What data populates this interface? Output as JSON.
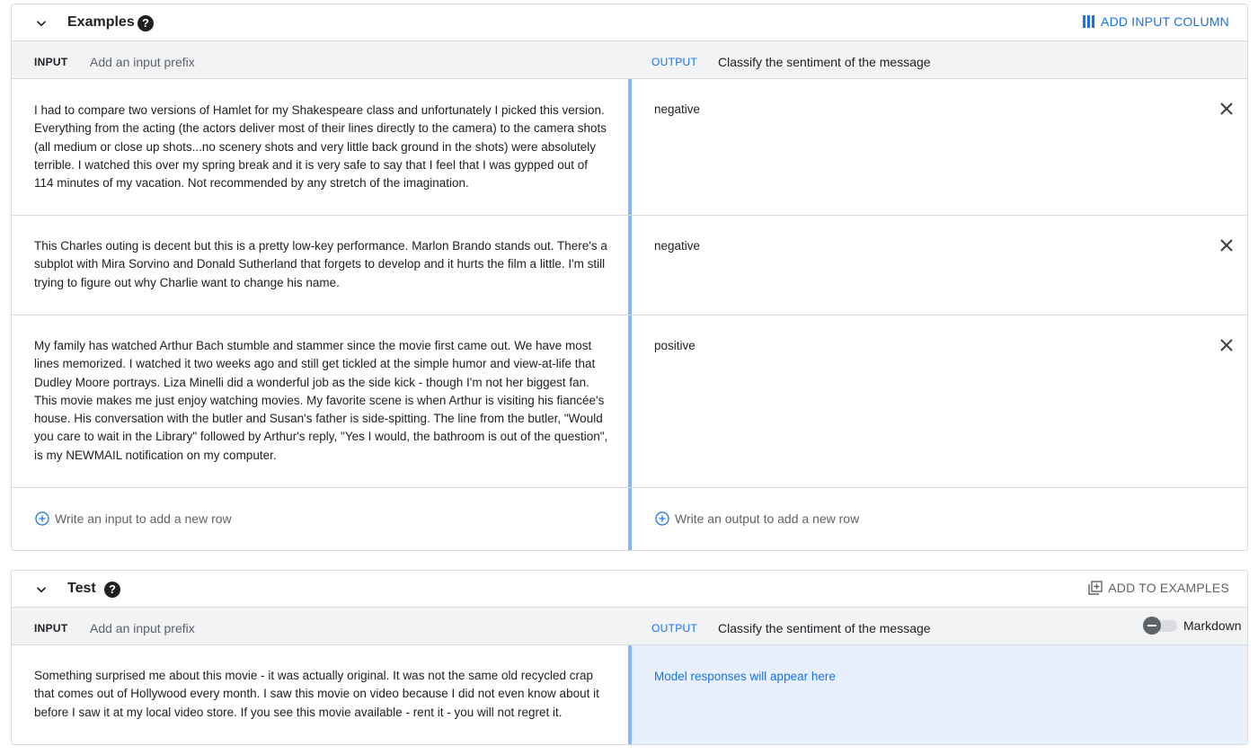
{
  "examples": {
    "title": "Examples",
    "help_icon": "?",
    "add_column_label": "ADD INPUT COLUMN",
    "input_header": "INPUT",
    "input_prefix_placeholder": "Add an input prefix",
    "output_header": "OUTPUT",
    "output_prefix": "Classify the sentiment of the message",
    "rows": [
      {
        "input": "I had to compare two versions of Hamlet for my Shakespeare class and unfortunately I picked this version. Everything from the acting (the actors deliver most of their lines directly to the camera) to the camera shots (all medium or close up shots...no scenery shots and very little back ground in the shots) were absolutely terrible. I watched this over my spring break and it is very safe to say that I feel that I was gypped out of 114 minutes of my vacation. Not recommended by any stretch of the imagination.",
        "output": "negative"
      },
      {
        "input": "This Charles outing is decent but this is a pretty low-key performance. Marlon Brando stands out. There's a subplot with Mira Sorvino and Donald Sutherland that forgets to develop and it hurts the film a little. I'm still trying to figure out why Charlie want to change his name.",
        "output": "negative"
      },
      {
        "input": "My family has watched Arthur Bach stumble and stammer since the movie first came out. We have most lines memorized. I watched it two weeks ago and still get tickled at the simple humor and view-at-life that Dudley Moore portrays. Liza Minelli did a wonderful job as the side kick - though I'm not her biggest fan. This movie makes me just enjoy watching movies. My favorite scene is when Arthur is visiting his fiancée's house. His conversation with the butler and Susan's father is side-spitting. The line from the butler, \"Would you care to wait in the Library\" followed by Arthur's reply, \"Yes I would, the bathroom is out of the question\", is my NEWMAIL notification on my computer.",
        "output": "positive"
      }
    ],
    "new_input_placeholder": "Write an input to add a new row",
    "new_output_placeholder": "Write an output to add a new row"
  },
  "test": {
    "title": "Test",
    "help_icon": "?",
    "add_to_examples_label": "ADD TO EXAMPLES",
    "input_header": "INPUT",
    "input_prefix_placeholder": "Add an input prefix",
    "output_header": "OUTPUT",
    "output_prefix": "Classify the sentiment of the message",
    "markdown_label": "Markdown",
    "markdown_enabled": false,
    "input": "Something surprised me about this movie - it was actually original. It was not the same old recycled crap that comes out of Hollywood every month. I saw this movie on video because I did not even know about it before I saw it at my local video store. If you see this movie available - rent it - you will not regret it.",
    "output_placeholder": "Model responses will appear here"
  },
  "icons": {
    "collapse": "chevron-down-icon",
    "help": "help-circle-icon",
    "add_column": "view-column-icon",
    "add_to_examples": "library-add-icon",
    "remove_row": "close-icon",
    "add_row": "add-circle-outline-icon",
    "markdown_toggle": "toggle-switch"
  },
  "colors": {
    "accent": "#1a73e8",
    "divider": "#8ab4f8",
    "output_bg": "#e8f0fe",
    "header_bg": "#f1f3f4",
    "muted_text": "#5f6368"
  }
}
